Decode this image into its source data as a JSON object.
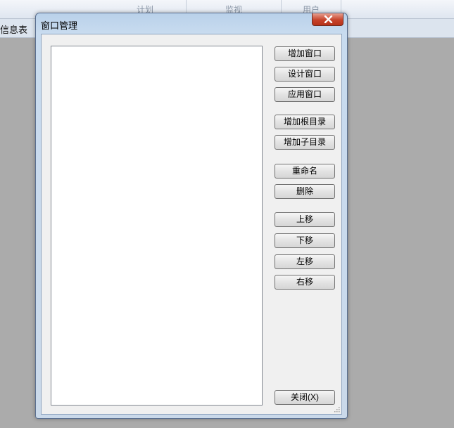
{
  "background": {
    "top_tabs": [
      "计划",
      "监视",
      "用户"
    ],
    "tabrow_label": "信息表"
  },
  "dialog": {
    "title": "窗口管理",
    "buttons": {
      "add_window": "增加窗口",
      "design_window": "设计窗口",
      "apply_window": "应用窗口",
      "add_root_dir": "增加根目录",
      "add_sub_dir": "增加子目录",
      "rename": "重命名",
      "delete": "删除",
      "move_up": "上移",
      "move_down": "下移",
      "move_left": "左移",
      "move_right": "右移",
      "close": "关闭(X)"
    },
    "icons": {
      "close": "close-icon",
      "resize": "resize-grip-icon"
    },
    "colors": {
      "close_button": "#c7432a",
      "title_bar": "#b9d1ea"
    }
  }
}
